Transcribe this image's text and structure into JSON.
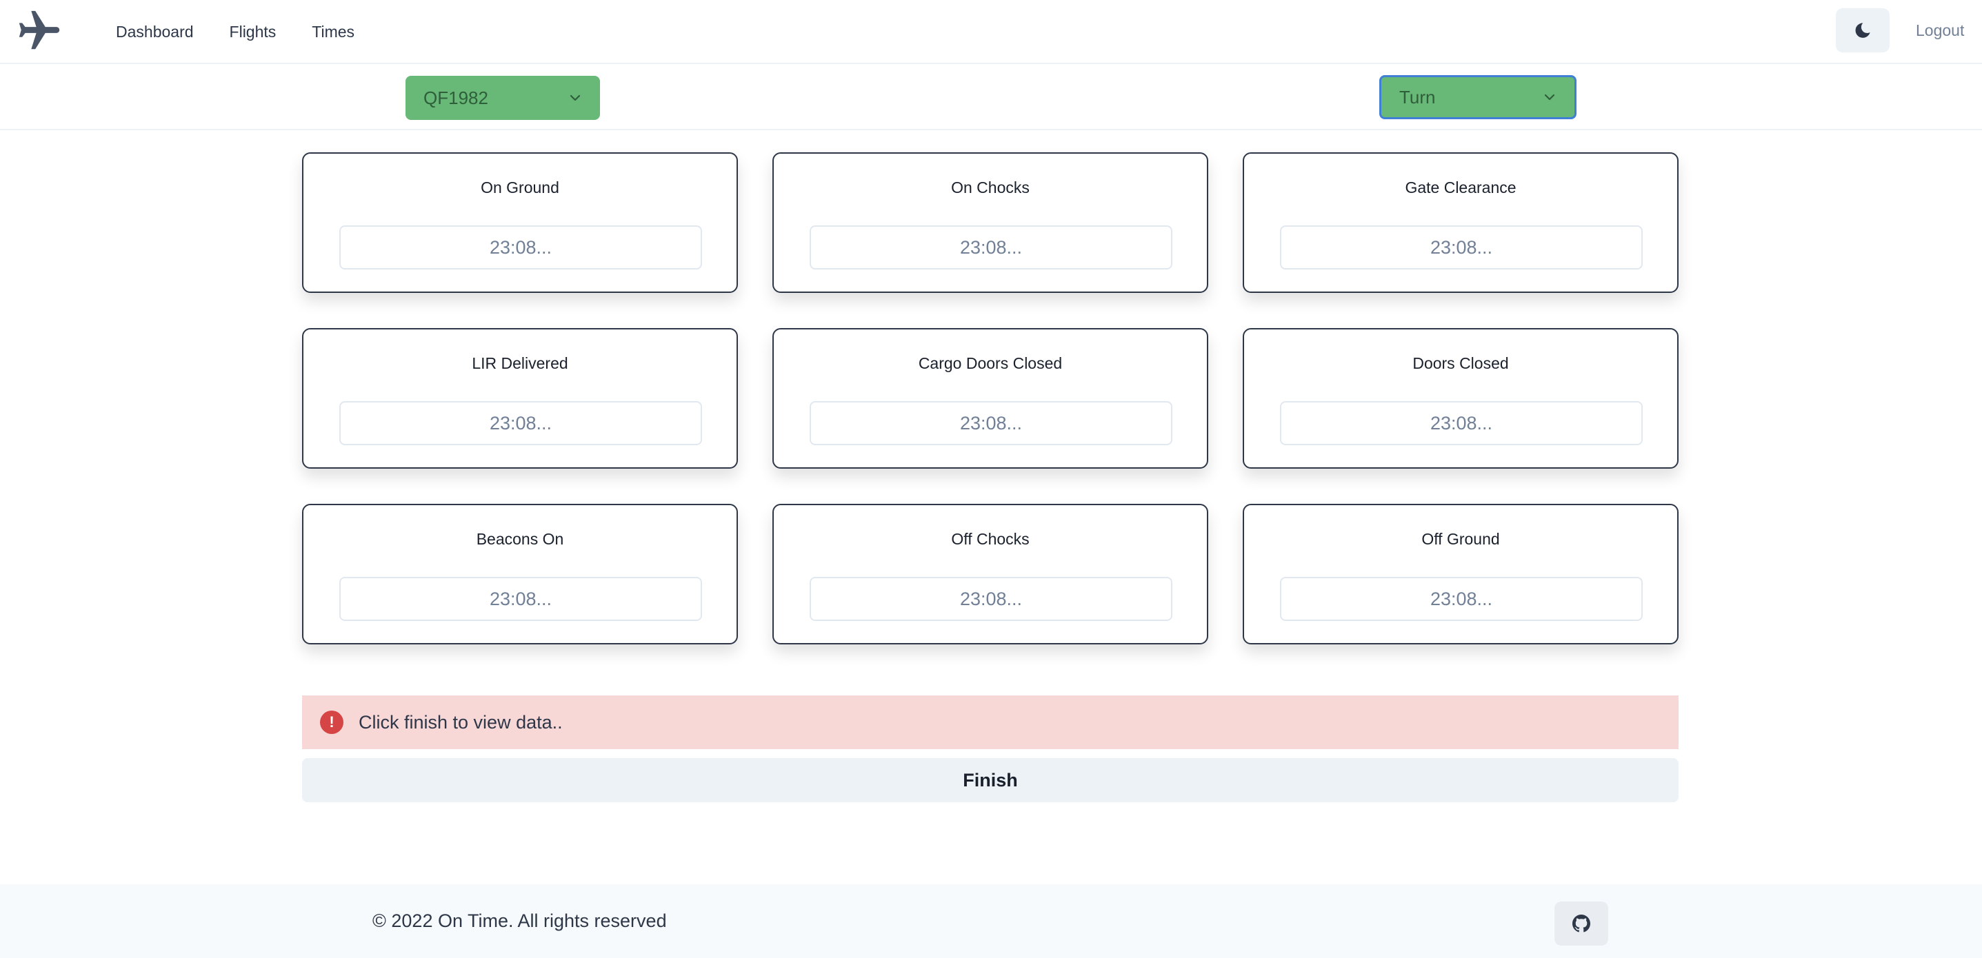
{
  "nav": {
    "logo_icon": "airplane-icon",
    "links": [
      "Dashboard",
      "Flights",
      "Times"
    ],
    "theme_toggle_icon": "moon-icon",
    "logout_label": "Logout"
  },
  "selectors": {
    "flight": {
      "value": "QF1982",
      "icon": "chevron-down-icon"
    },
    "mode": {
      "value": "Turn",
      "icon": "chevron-down-icon"
    }
  },
  "cards": [
    {
      "title": "On Ground",
      "placeholder": "23:08..."
    },
    {
      "title": "On Chocks",
      "placeholder": "23:08..."
    },
    {
      "title": "Gate Clearance",
      "placeholder": "23:08..."
    },
    {
      "title": "LIR Delivered",
      "placeholder": "23:08..."
    },
    {
      "title": "Cargo Doors Closed",
      "placeholder": "23:08..."
    },
    {
      "title": "Doors Closed",
      "placeholder": "23:08..."
    },
    {
      "title": "Beacons On",
      "placeholder": "23:08..."
    },
    {
      "title": "Off Chocks",
      "placeholder": "23:08..."
    },
    {
      "title": "Off Ground",
      "placeholder": "23:08..."
    }
  ],
  "alert": {
    "icon_text": "!",
    "message": "Click finish to view data.."
  },
  "finish_label": "Finish",
  "footer": {
    "copyright": "© 2022 On Time. All rights reserved",
    "github_icon": "github-icon"
  },
  "colors": {
    "select_bg": "#68b877",
    "alert_bg": "#f8d7d7",
    "alert_icon": "#d64545",
    "focus_border": "#3f7fd6"
  }
}
